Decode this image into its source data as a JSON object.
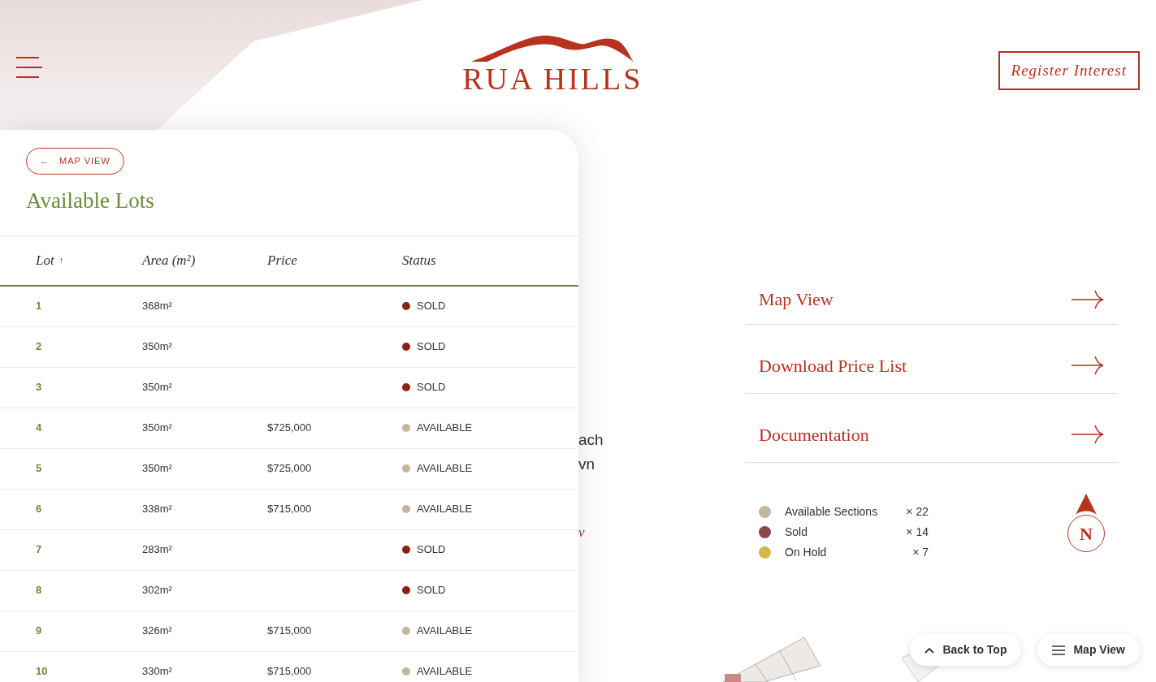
{
  "header": {
    "logo_text": "RUA HILLS",
    "register_button": "Register Interest"
  },
  "panel": {
    "back_button": {
      "arrow": "←",
      "label": "MAP VIEW"
    },
    "title": "Available Lots",
    "columns": [
      {
        "label": "Lot",
        "sort_mark": "↑"
      },
      {
        "label": "Area (m²)"
      },
      {
        "label": "Price"
      },
      {
        "label": "Status"
      }
    ],
    "rows": [
      {
        "lot": "1",
        "area": "368m²",
        "price": "",
        "status": "SOLD",
        "color": "#8b2216"
      },
      {
        "lot": "2",
        "area": "350m²",
        "price": "",
        "status": "SOLD",
        "color": "#8b2216"
      },
      {
        "lot": "3",
        "area": "350m²",
        "price": "",
        "status": "SOLD",
        "color": "#8b2216"
      },
      {
        "lot": "4",
        "area": "350m²",
        "price": "$725,000",
        "status": "AVAILABLE",
        "color": "#c4b5a0"
      },
      {
        "lot": "5",
        "area": "350m²",
        "price": "$725,000",
        "status": "AVAILABLE",
        "color": "#c4b5a0"
      },
      {
        "lot": "6",
        "area": "338m²",
        "price": "$715,000",
        "status": "AVAILABLE",
        "color": "#c4b5a0"
      },
      {
        "lot": "7",
        "area": "283m²",
        "price": "",
        "status": "SOLD",
        "color": "#8b2216"
      },
      {
        "lot": "8",
        "area": "302m²",
        "price": "",
        "status": "SOLD",
        "color": "#8b2216"
      },
      {
        "lot": "9",
        "area": "326m²",
        "price": "$715,000",
        "status": "AVAILABLE",
        "color": "#c4b5a0"
      },
      {
        "lot": "10",
        "area": "330m²",
        "price": "$715,000",
        "status": "AVAILABLE",
        "color": "#c4b5a0"
      }
    ]
  },
  "hidden_text_fragments": [
    "ach",
    "vn",
    "v"
  ],
  "links": [
    {
      "label": "Map View"
    },
    {
      "label": "Download Price List"
    },
    {
      "label": "Documentation"
    }
  ],
  "legend": [
    {
      "label": "Available Sections",
      "count": "× 22",
      "color": "#c4b5a0"
    },
    {
      "label": "Sold",
      "count": "× 14",
      "color": "#8b4a4a"
    },
    {
      "label": "On Hold",
      "count": "× 7",
      "color": "#d4b84a"
    }
  ],
  "compass": {
    "letter": "N"
  },
  "floating_buttons": [
    {
      "kind": "up",
      "label": "Back to Top"
    },
    {
      "kind": "menu",
      "label": "Map View"
    }
  ]
}
